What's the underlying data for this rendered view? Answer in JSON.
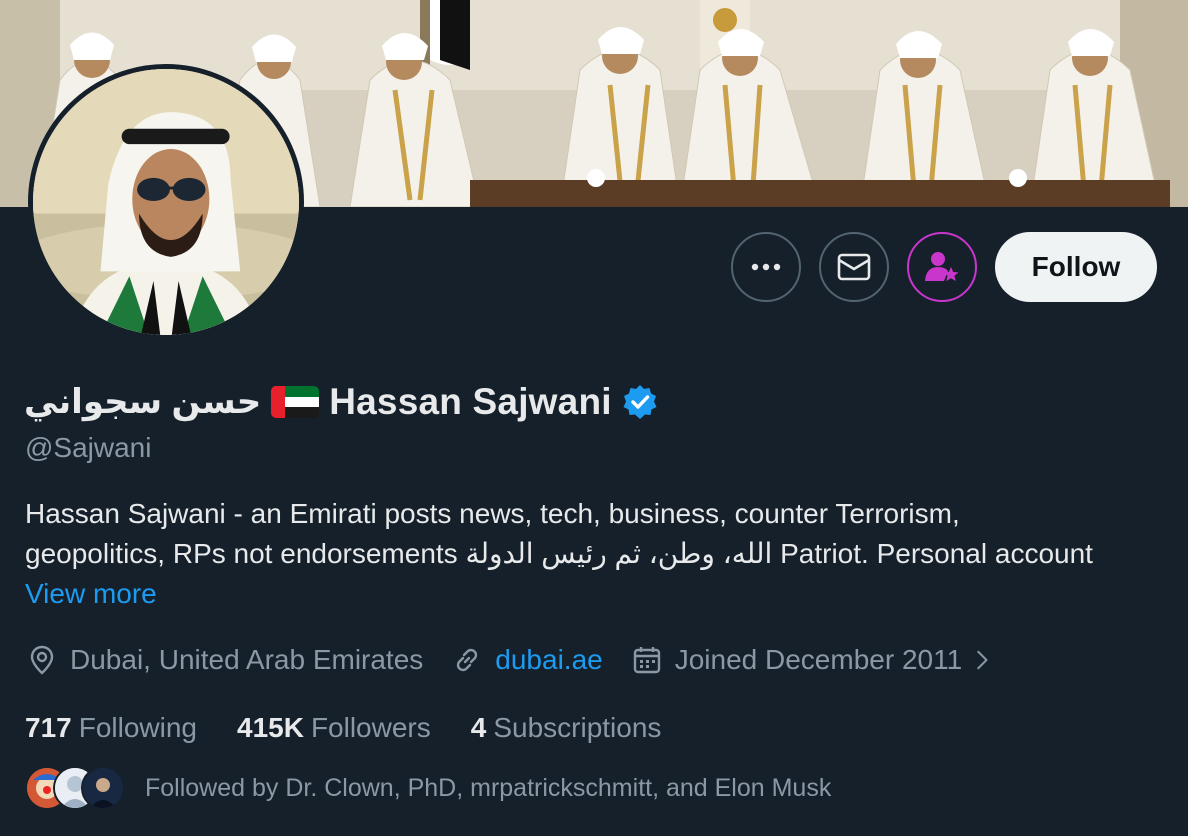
{
  "header": {
    "banner_alt": "Banner photo of men in white kanduras seated at an event",
    "avatar_alt": "Profile photo"
  },
  "actions": {
    "more_icon": "more-horizontal-icon",
    "message_icon": "envelope-icon",
    "subscribe_icon": "subscribe-person-star-icon",
    "follow_label": "Follow"
  },
  "profile": {
    "arabic_name": "حسن سجواني",
    "flag": "uae-flag",
    "name": "Hassan Sajwani",
    "verified": true,
    "handle": "@Sajwani",
    "bio_line1": "Hassan Sajwani - an Emirati posts news, tech, business, counter Terrorism,",
    "bio_line2_start": "geopolitics, RPs not endorsements ",
    "bio_line2_arabic": "الله، وطن، ثم رئيس الدولة",
    "bio_line2_end": " Patriot. Personal account",
    "view_more": "View more"
  },
  "meta": {
    "location": "Dubai, United Arab Emirates",
    "website": "dubai.ae",
    "joined": "Joined December 2011"
  },
  "stats": {
    "following_count": "717",
    "following_label": "Following",
    "followers_count": "415K",
    "followers_label": "Followers",
    "subscriptions_count": "4",
    "subscriptions_label": "Subscriptions"
  },
  "followed_by": {
    "text": "Followed by Dr. Clown, PhD, mrpatrickschmitt, and Elon Musk"
  },
  "colors": {
    "background": "#15202b",
    "accent": "#1d9bf0",
    "muted": "#8b98a5",
    "subscribe": "#c936cc",
    "follow_bg": "#eff3f4"
  }
}
